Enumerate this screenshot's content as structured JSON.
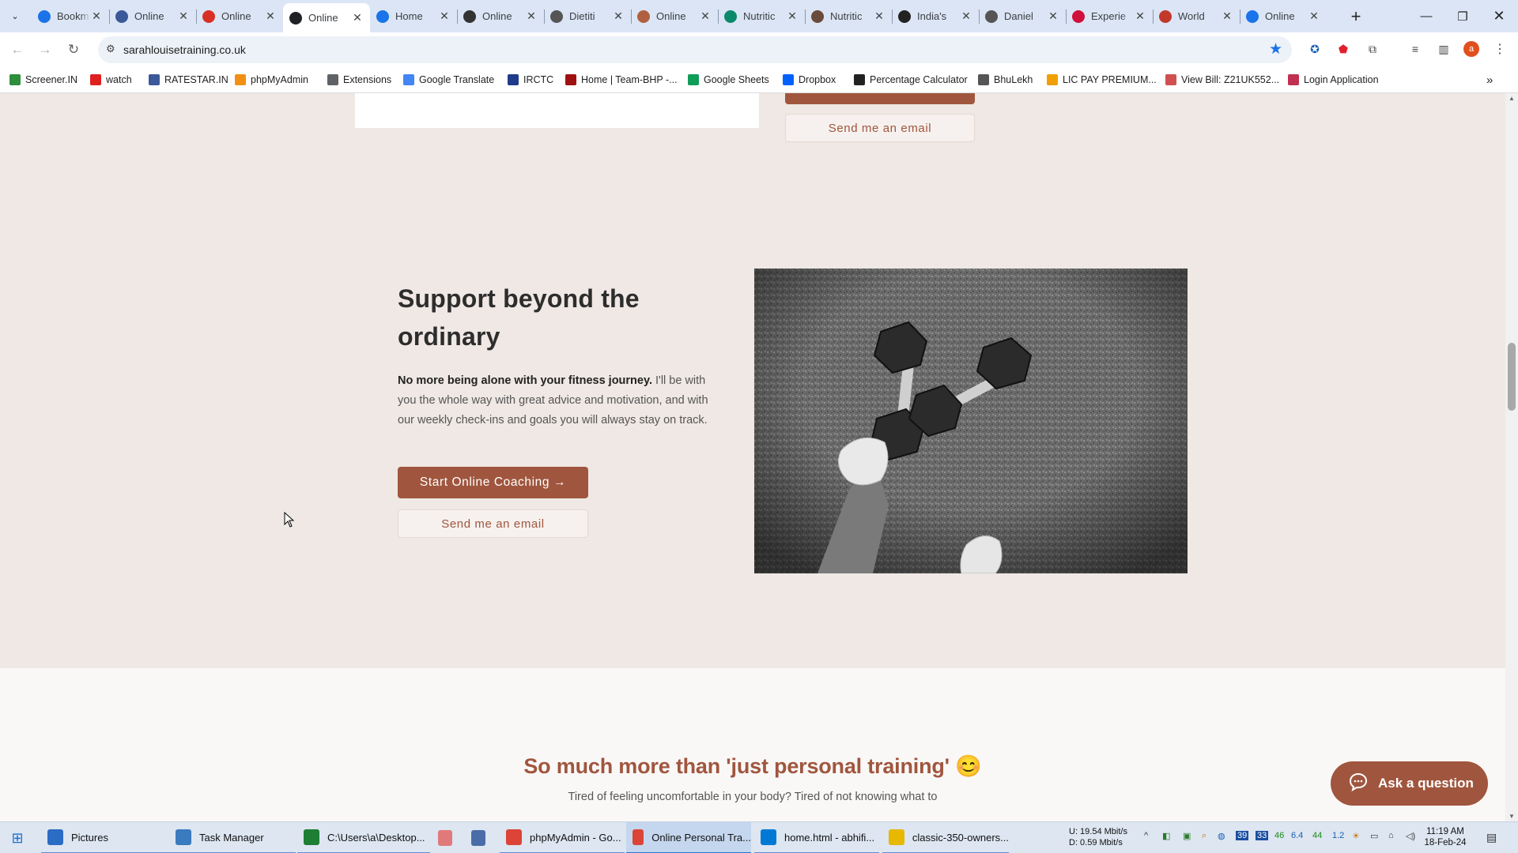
{
  "browser": {
    "tabs": [
      {
        "title": "Bookm",
        "icon": "star-icon",
        "color": "#1a73e8"
      },
      {
        "title": "Online",
        "icon": "globe-icon",
        "color": "#3b5998"
      },
      {
        "title": "Online",
        "icon": "target-icon",
        "color": "#d93025"
      },
      {
        "title": "Online",
        "icon": "circle-logo-icon",
        "color": "#202124",
        "active": true
      },
      {
        "title": "Home",
        "icon": "help-icon",
        "color": "#1a73e8"
      },
      {
        "title": "Online",
        "icon": "wf-logo-icon",
        "color": "#333333"
      },
      {
        "title": "Dietiti",
        "icon": "leaf-logo-icon",
        "color": "#555555"
      },
      {
        "title": "Online",
        "icon": "a-logo-icon",
        "color": "#b06040"
      },
      {
        "title": "Nutritic",
        "icon": "drop-icon",
        "color": "#0a8a6a"
      },
      {
        "title": "Nutritic",
        "icon": "person-icon",
        "color": "#6a4a3a"
      },
      {
        "title": "India's",
        "icon": "map-pin-icon",
        "color": "#222222"
      },
      {
        "title": "Daniel",
        "icon": "d-logo-icon",
        "color": "#555555"
      },
      {
        "title": "Experie",
        "icon": "e-logo-icon",
        "color": "#d0103a"
      },
      {
        "title": "World",
        "icon": "up-logo-icon",
        "color": "#c0392b"
      },
      {
        "title": "Online",
        "icon": "lines-logo-icon",
        "color": "#1a73e8"
      }
    ],
    "new_tab": "+",
    "url": "sarahlouisetraining.co.uk",
    "bookmarks": [
      {
        "label": "Screener.IN",
        "color": "#2d8f3a"
      },
      {
        "label": "watch",
        "color": "#e02020"
      },
      {
        "label": "RATESTAR.IN",
        "color": "#3b5998"
      },
      {
        "label": "phpMyAdmin",
        "color": "#f29111"
      },
      {
        "label": "Extensions",
        "color": "#5f6368"
      },
      {
        "label": "Google Translate",
        "color": "#4285f4"
      },
      {
        "label": "IRCTC",
        "color": "#1f3b8a"
      },
      {
        "label": "Home | Team-BHP -...",
        "color": "#a01010"
      },
      {
        "label": "Google Sheets",
        "color": "#0f9d58"
      },
      {
        "label": "Dropbox",
        "color": "#0061fe"
      },
      {
        "label": "Percentage Calculator",
        "color": "#222222"
      },
      {
        "label": "BhuLekh",
        "color": "#555555"
      },
      {
        "label": "LIC PAY PREMIUM...",
        "color": "#f0a000"
      },
      {
        "label": "View Bill: Z21UK552...",
        "color": "#d05050"
      },
      {
        "label": "Login Application",
        "color": "#c03050"
      }
    ]
  },
  "page": {
    "top_email_button": "Send me an email",
    "section": {
      "headline": "Support beyond the ordinary",
      "intro_bold": "No more being alone with your fitness journey.",
      "intro_rest": " I'll be with you the whole way with great advice and motivation, and with our weekly check-ins and goals you will always stay on track.",
      "primary_button": "Start Online Coaching →",
      "secondary_button": "Send me an email"
    },
    "lower": {
      "title": "So much more than 'just personal training' 😊",
      "subtitle": "Tired of feeling uncomfortable in your body? Tired of not knowing what to"
    },
    "chat_button": "Ask a question"
  },
  "taskbar": {
    "items": [
      {
        "label": "Pictures",
        "color": "#2b6cc4"
      },
      {
        "label": "Task Manager",
        "color": "#3a7abf"
      },
      {
        "label": "C:\\Users\\a\\Desktop...",
        "color": "#1e7e34"
      },
      {
        "label": "",
        "color": "#e07a7a"
      },
      {
        "label": "",
        "color": "#4a6da7"
      },
      {
        "label": "phpMyAdmin - Go...",
        "color": "#db4437"
      },
      {
        "label": "Online Personal Tra...",
        "color": "#db4437",
        "active": true
      },
      {
        "label": "home.html - abhifi...",
        "color": "#0078d4"
      },
      {
        "label": "classic-350-owners...",
        "color": "#e6b800"
      }
    ],
    "network_up": "U:   19.54 Mbit/s",
    "network_down": "D:   0.59 Mbit/s",
    "tray_numbers": [
      "46",
      "6.4",
      "44",
      "1.2"
    ],
    "time": "11:19 AM",
    "date": "18-Feb-24"
  }
}
